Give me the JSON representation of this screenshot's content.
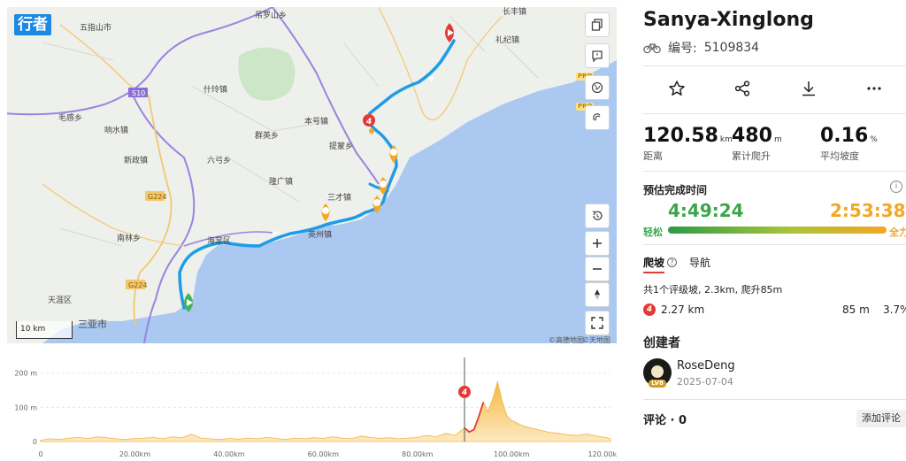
{
  "brand": "行者",
  "map": {
    "place_labels": [
      {
        "text": "五指山市"
      },
      {
        "text": "吊罗山乡"
      },
      {
        "text": "长丰镇"
      },
      {
        "text": "礼纪镇"
      },
      {
        "text": "什玲镇"
      },
      {
        "text": "毛感乡"
      },
      {
        "text": "响水镇"
      },
      {
        "text": "本号镇"
      },
      {
        "text": "群英乡"
      },
      {
        "text": "提蒙乡"
      },
      {
        "text": "新政镇"
      },
      {
        "text": "六弓乡"
      },
      {
        "text": "隆广镇"
      },
      {
        "text": "三才镇"
      },
      {
        "text": "英州镇"
      },
      {
        "text": "南林乡"
      },
      {
        "text": "海棠区"
      },
      {
        "text": "天涯区"
      },
      {
        "text": "三亚市"
      }
    ],
    "road_labels": [
      "S10",
      "G224",
      "G224"
    ],
    "climb_marker": "4",
    "scale": "10 km",
    "attributions": [
      "©高德地图",
      "©天地图"
    ],
    "pro_label": "PRO"
  },
  "elevation": {
    "y_ticks": [
      "200 m",
      "100 m",
      "0"
    ],
    "x_ticks": [
      "0",
      "20.00km",
      "40.00km",
      "60.00km",
      "80.00km",
      "100.00km",
      "120.00km"
    ],
    "x_max_km": 121,
    "y_max_m": 225,
    "cursor_km": 90,
    "climb_marker": "4",
    "profile_km": [
      0,
      2,
      4,
      6,
      8,
      10,
      12,
      14,
      16,
      18,
      20,
      22,
      24,
      26,
      28,
      30,
      32,
      34,
      36,
      38,
      40,
      42,
      44,
      46,
      48,
      50,
      52,
      54,
      56,
      58,
      60,
      62,
      64,
      66,
      68,
      70,
      72,
      74,
      76,
      78,
      80,
      82,
      84,
      86,
      88,
      90,
      91,
      92,
      93,
      94,
      95,
      96,
      97,
      98,
      99,
      100,
      102,
      104,
      106,
      108,
      110,
      112,
      114,
      116,
      118,
      120,
      121
    ],
    "profile_m": [
      4,
      8,
      6,
      10,
      12,
      9,
      14,
      11,
      8,
      6,
      9,
      10,
      12,
      8,
      14,
      11,
      22,
      10,
      8,
      6,
      9,
      7,
      10,
      8,
      12,
      9,
      6,
      10,
      8,
      11,
      9,
      14,
      10,
      8,
      16,
      12,
      9,
      11,
      8,
      10,
      12,
      18,
      14,
      24,
      18,
      40,
      28,
      35,
      72,
      115,
      88,
      125,
      175,
      118,
      75,
      62,
      48,
      40,
      33,
      27,
      24,
      20,
      18,
      22,
      16,
      12,
      8
    ],
    "climb_km": [
      88.5,
      94.5
    ]
  },
  "route": {
    "title": "Sanya-Xinglong",
    "id_label": "编号:",
    "id_value": "5109834"
  },
  "stats": [
    {
      "value": "120.58",
      "unit": "km",
      "label": "距离"
    },
    {
      "value": "480",
      "unit": "m",
      "label": "累计爬升"
    },
    {
      "value": "0.16",
      "unit": "%",
      "label": "平均坡度"
    }
  ],
  "estimate": {
    "heading": "预估完成时间",
    "easy_time": "4:49:24",
    "hard_time": "2:53:38",
    "easy_label": "轻松",
    "hard_label": "全力"
  },
  "tabs": {
    "climb": "爬坡",
    "nav": "导航"
  },
  "climbs": {
    "summary": "共1个评级坡, 2.3km, 爬升85m",
    "row": {
      "category": "4",
      "length": "2.27 km",
      "gain": "85 m",
      "grade": "3.7%"
    }
  },
  "creator": {
    "heading": "创建者",
    "name": "RoseDeng",
    "date": "2025-07-04",
    "badge": "LV8"
  },
  "comments": {
    "heading": "评论 · 0",
    "button": "添加评论"
  },
  "colors": {
    "route": "#1e9be9",
    "accent_red": "#e53935",
    "easy": "#3aa64a",
    "hard": "#f5a623",
    "sea": "#aac8f0"
  }
}
